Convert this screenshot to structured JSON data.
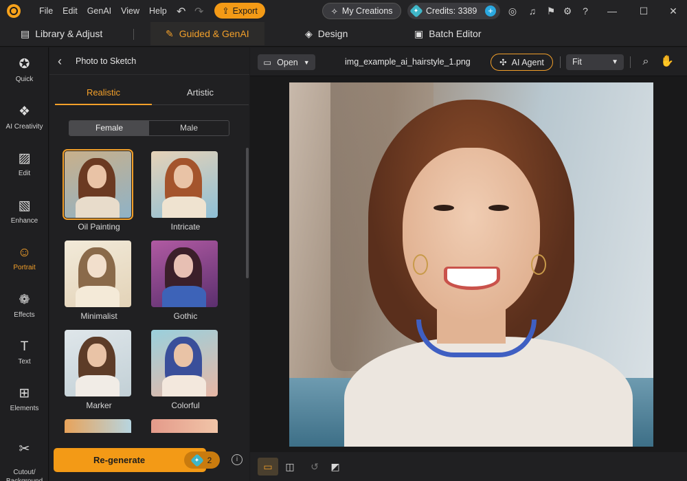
{
  "menu": {
    "file": "File",
    "edit": "Edit",
    "genai": "GenAI",
    "view": "View",
    "help": "Help"
  },
  "titlebar": {
    "export_label": "Export",
    "my_creations_label": "My Creations",
    "credits_label": "Credits: 3389"
  },
  "modes": {
    "library": "Library & Adjust",
    "guided": "Guided & GenAI",
    "design": "Design",
    "batch": "Batch Editor"
  },
  "rail": [
    {
      "label": "Quick",
      "icon": "magic-wand-icon"
    },
    {
      "label": "AI Creativity",
      "icon": "ai-creativity-icon"
    },
    {
      "label": "Edit",
      "icon": "edit-image-icon"
    },
    {
      "label": "Enhance",
      "icon": "enhance-icon"
    },
    {
      "label": "Portrait",
      "icon": "portrait-icon"
    },
    {
      "label": "Effects",
      "icon": "effects-icon"
    },
    {
      "label": "Text",
      "icon": "text-icon"
    },
    {
      "label": "Elements",
      "icon": "elements-icon"
    },
    {
      "label": "Cutout/\nBackground",
      "icon": "cutout-icon"
    }
  ],
  "panel": {
    "title": "Photo to Sketch",
    "tabs": [
      "Realistic",
      "Artistic"
    ],
    "active_tab": "Realistic",
    "gender": [
      "Female",
      "Male"
    ],
    "active_gender": "Female",
    "styles": [
      "Oil Painting",
      "Intricate",
      "Minimalist",
      "Gothic",
      "Marker",
      "Colorful"
    ],
    "selected_style": "Oil Painting",
    "regenerate_label": "Re-generate",
    "regenerate_cost": "2"
  },
  "canvas": {
    "open_label": "Open",
    "filename": "img_example_ai_hairstyle_1.png",
    "ai_agent_label": "AI Agent",
    "zoom": "Fit"
  },
  "colors": {
    "accent": "#f3a02a",
    "background": "#1b1b1d",
    "panel": "#202022"
  }
}
